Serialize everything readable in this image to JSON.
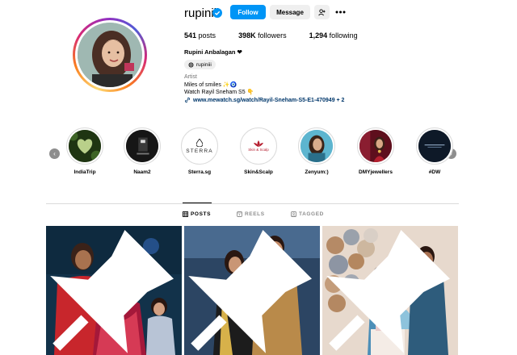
{
  "profile": {
    "username": "rupiniii",
    "verified": true,
    "follow_label": "Follow",
    "message_label": "Message",
    "stats": {
      "posts": "541",
      "posts_label": "posts",
      "followers": "398K",
      "followers_label": "followers",
      "following": "1,294",
      "following_label": "following"
    },
    "full_name": "Rupini Anbalagan ❤",
    "threads_handle": "rupiniii",
    "category": "Artist",
    "bio_line1": "Miles of smiles ✨🧿",
    "bio_line2": "Watch Rayil Sneham S5 👇",
    "link": "www.mewatch.sg/watch/Rayil-Sneham-S5-E1-470949 + 2"
  },
  "highlights": [
    {
      "label": "IndiaTrip",
      "icon": "forest-heart"
    },
    {
      "label": "Naam2",
      "icon": "dark-poster"
    },
    {
      "label": "Sterra.sg",
      "icon": "sterra-logo",
      "logo_text": "STERRA"
    },
    {
      "label": "Skin&Scalp",
      "icon": "skin-scalp-logo",
      "logo_text": "Skin & Scalp"
    },
    {
      "label": "Zenyum:)",
      "icon": "portrait"
    },
    {
      "label": "DMYjewellers",
      "icon": "jewellery"
    },
    {
      "label": "#DW",
      "icon": "dark-logo"
    }
  ],
  "tabs": [
    {
      "label": "POSTS",
      "active": true
    },
    {
      "label": "REELS",
      "active": false
    },
    {
      "label": "TAGGED",
      "active": false
    }
  ],
  "posts": [
    {
      "pinned": true,
      "scene": "family-red-festive"
    },
    {
      "pinned": true,
      "scene": "couple-award"
    },
    {
      "pinned": true,
      "scene": "family-balloons"
    }
  ],
  "colors": {
    "accent": "#0095f6",
    "button_bg": "#efefef",
    "muted": "#737373",
    "link": "#00376b"
  }
}
